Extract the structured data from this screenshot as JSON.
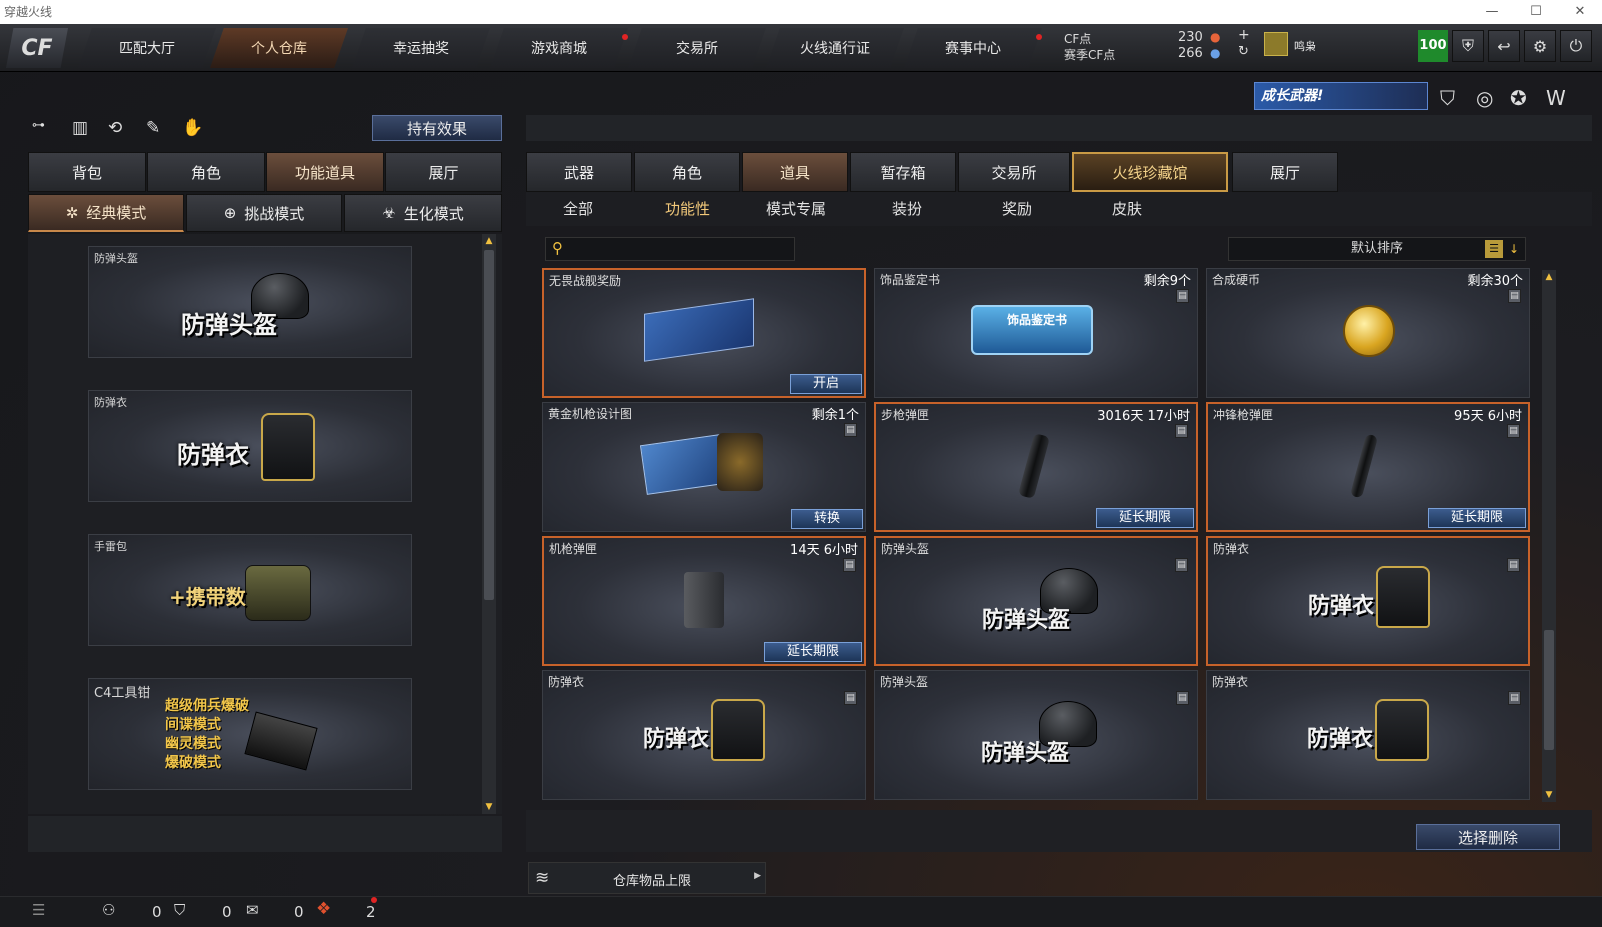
{
  "window": {
    "title": "穿越火线"
  },
  "nav": {
    "tabs": [
      "匹配大厅",
      "个人仓库",
      "幸运抽奖",
      "游戏商城",
      "交易所",
      "火线通行证",
      "赛事中心"
    ]
  },
  "points": {
    "cf_label": "CF点",
    "cf_value": "230",
    "season_label": "赛季CF点",
    "season_value": "266"
  },
  "user": {
    "name": "鸣枭",
    "level_badge": "100"
  },
  "left": {
    "effects_button": "持有效果",
    "tabs": [
      "背包",
      "角色",
      "功能道具",
      "展厅"
    ],
    "modes": [
      "经典模式",
      "挑战模式",
      "生化模式"
    ],
    "cards": [
      {
        "name": "防弹头盔",
        "label": "防弹头盔"
      },
      {
        "name": "防弹衣",
        "label": "防弹衣"
      },
      {
        "name": "手雷包",
        "label": "+携带数"
      },
      {
        "name": "C4工具钳",
        "lines": [
          "超级佣兵爆破",
          "间谍模式",
          "幽灵模式",
          "爆破模式"
        ]
      }
    ]
  },
  "right": {
    "banner": "成长武器!",
    "tabs": [
      "武器",
      "角色",
      "道具",
      "暂存箱",
      "交易所",
      "火线珍藏馆",
      "展厅"
    ],
    "subtabs": [
      "全部",
      "功能性",
      "模式专属",
      "装扮",
      "奖励",
      "皮肤"
    ],
    "sort": "默认排序",
    "items": [
      {
        "name": "无畏战舰奖励",
        "right": "",
        "action": "开启"
      },
      {
        "name": "饰品鉴定书",
        "right": "剩余9个",
        "action": ""
      },
      {
        "name": "合成硬币",
        "right": "剩余30个",
        "action": ""
      },
      {
        "name": "黄金机枪设计图",
        "right": "剩余1个",
        "action": "转换"
      },
      {
        "name": "步枪弹匣",
        "right": "3016天 17小时",
        "action": "延长期限"
      },
      {
        "name": "冲锋枪弹匣",
        "right": "95天 6小时",
        "action": "延长期限"
      },
      {
        "name": "机枪弹匣",
        "right": "14天 6小时",
        "action": "延长期限"
      },
      {
        "name": "防弹头盔",
        "right": "",
        "action": "",
        "big": "防弹头盔"
      },
      {
        "name": "防弹衣",
        "right": "",
        "action": "",
        "big": "防弹衣"
      },
      {
        "name": "防弹衣",
        "right": "",
        "action": "",
        "big": "防弹衣"
      },
      {
        "name": "防弹头盔",
        "right": "",
        "action": "",
        "big": "防弹头盔"
      },
      {
        "name": "防弹衣",
        "right": "",
        "action": "",
        "big": "防弹衣"
      }
    ],
    "delete_button": "选择删除",
    "storage_limit": "仓库物品上限",
    "badge_text": "饰品鉴定书"
  },
  "bottom": {
    "count1": "0",
    "count2": "0",
    "count3": "0",
    "count4": "2"
  }
}
